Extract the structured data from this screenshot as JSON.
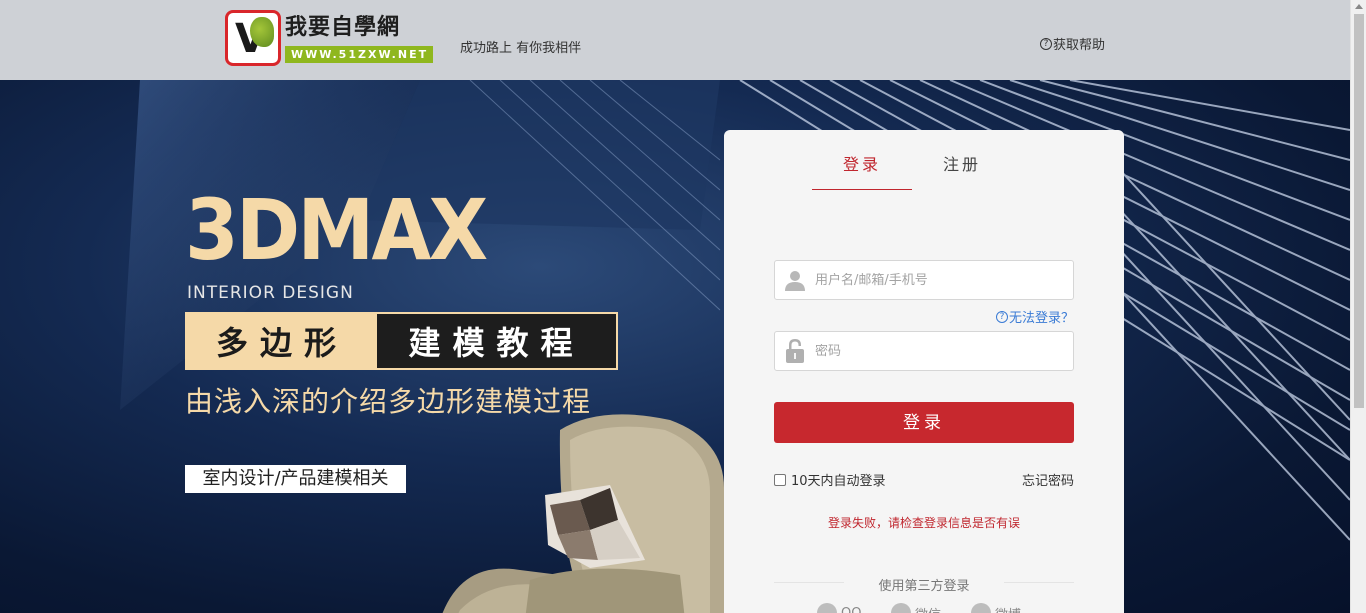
{
  "header": {
    "logo_title": "我要自學網",
    "logo_url": "WWW.51ZXW.NET",
    "slogan": "成功路上 有你我相伴",
    "help_label": "获取帮助",
    "help_icon": "question-circle-icon"
  },
  "banner": {
    "title": "3DMAX",
    "subtitle_en": "INTERIOR DESIGN",
    "tag_left": "多边形",
    "tag_right": "建模教程",
    "description": "由浅入深的介绍多边形建模过程",
    "category": "室内设计/产品建模相关",
    "colors": {
      "gold": "#f5d9a8",
      "dark": "#0b1a33"
    }
  },
  "login": {
    "tabs": [
      {
        "label": "登录",
        "active": true
      },
      {
        "label": "注册",
        "active": false
      }
    ],
    "username_placeholder": "用户名/邮箱/手机号",
    "password_placeholder": "密码",
    "cant_login": "无法登录？",
    "submit_label": "登录",
    "remember_label": "10天内自动登录",
    "forgot_label": "忘记密码",
    "error_message": "登录失败，请检查登录信息是否有误",
    "third_party_label": "使用第三方登录",
    "social": [
      {
        "label": "QQ",
        "icon": "qq-icon"
      },
      {
        "label": "微信",
        "icon": "wechat-icon"
      },
      {
        "label": "微博",
        "icon": "weibo-icon"
      }
    ],
    "accent_color": "#c7282e"
  }
}
